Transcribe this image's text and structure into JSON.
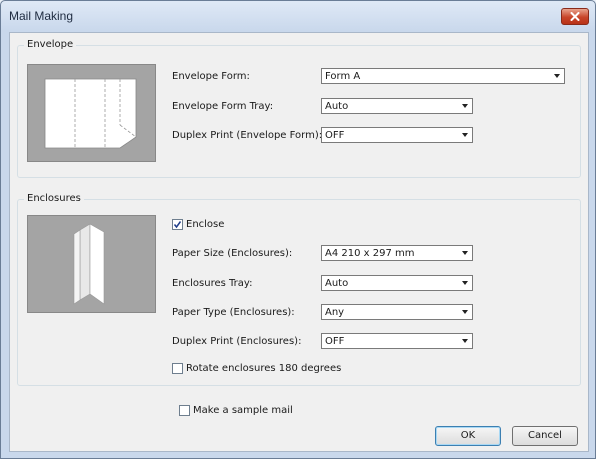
{
  "window": {
    "title": "Mail Making"
  },
  "envelope": {
    "group_label": "Envelope",
    "form_label": "Envelope Form:",
    "form_value": "Form A",
    "tray_label": "Envelope Form Tray:",
    "tray_value": "Auto",
    "duplex_label": "Duplex Print (Envelope Form):",
    "duplex_value": "OFF"
  },
  "enclosures": {
    "group_label": "Enclosures",
    "enclose_label": "Enclose",
    "enclose_checked": true,
    "paper_size_label": "Paper Size (Enclosures):",
    "paper_size_value": "A4 210 x 297 mm",
    "tray_label": "Enclosures Tray:",
    "tray_value": "Auto",
    "paper_type_label": "Paper Type (Enclosures):",
    "paper_type_value": "Any",
    "duplex_label": "Duplex Print (Enclosures):",
    "duplex_value": "OFF",
    "rotate_label": "Rotate enclosures 180 degrees",
    "rotate_checked": false
  },
  "sample_mail_label": "Make a sample mail",
  "sample_mail_checked": false,
  "buttons": {
    "ok": "OK",
    "cancel": "Cancel"
  },
  "icons": {
    "close": "close-icon",
    "checkmark": "checkmark-icon",
    "dropdown": "chevron-down-icon"
  },
  "colors": {
    "close_button": "#c8452a",
    "preview_bg": "#a4a4a4",
    "default_button_border": "#3c7fb1"
  }
}
